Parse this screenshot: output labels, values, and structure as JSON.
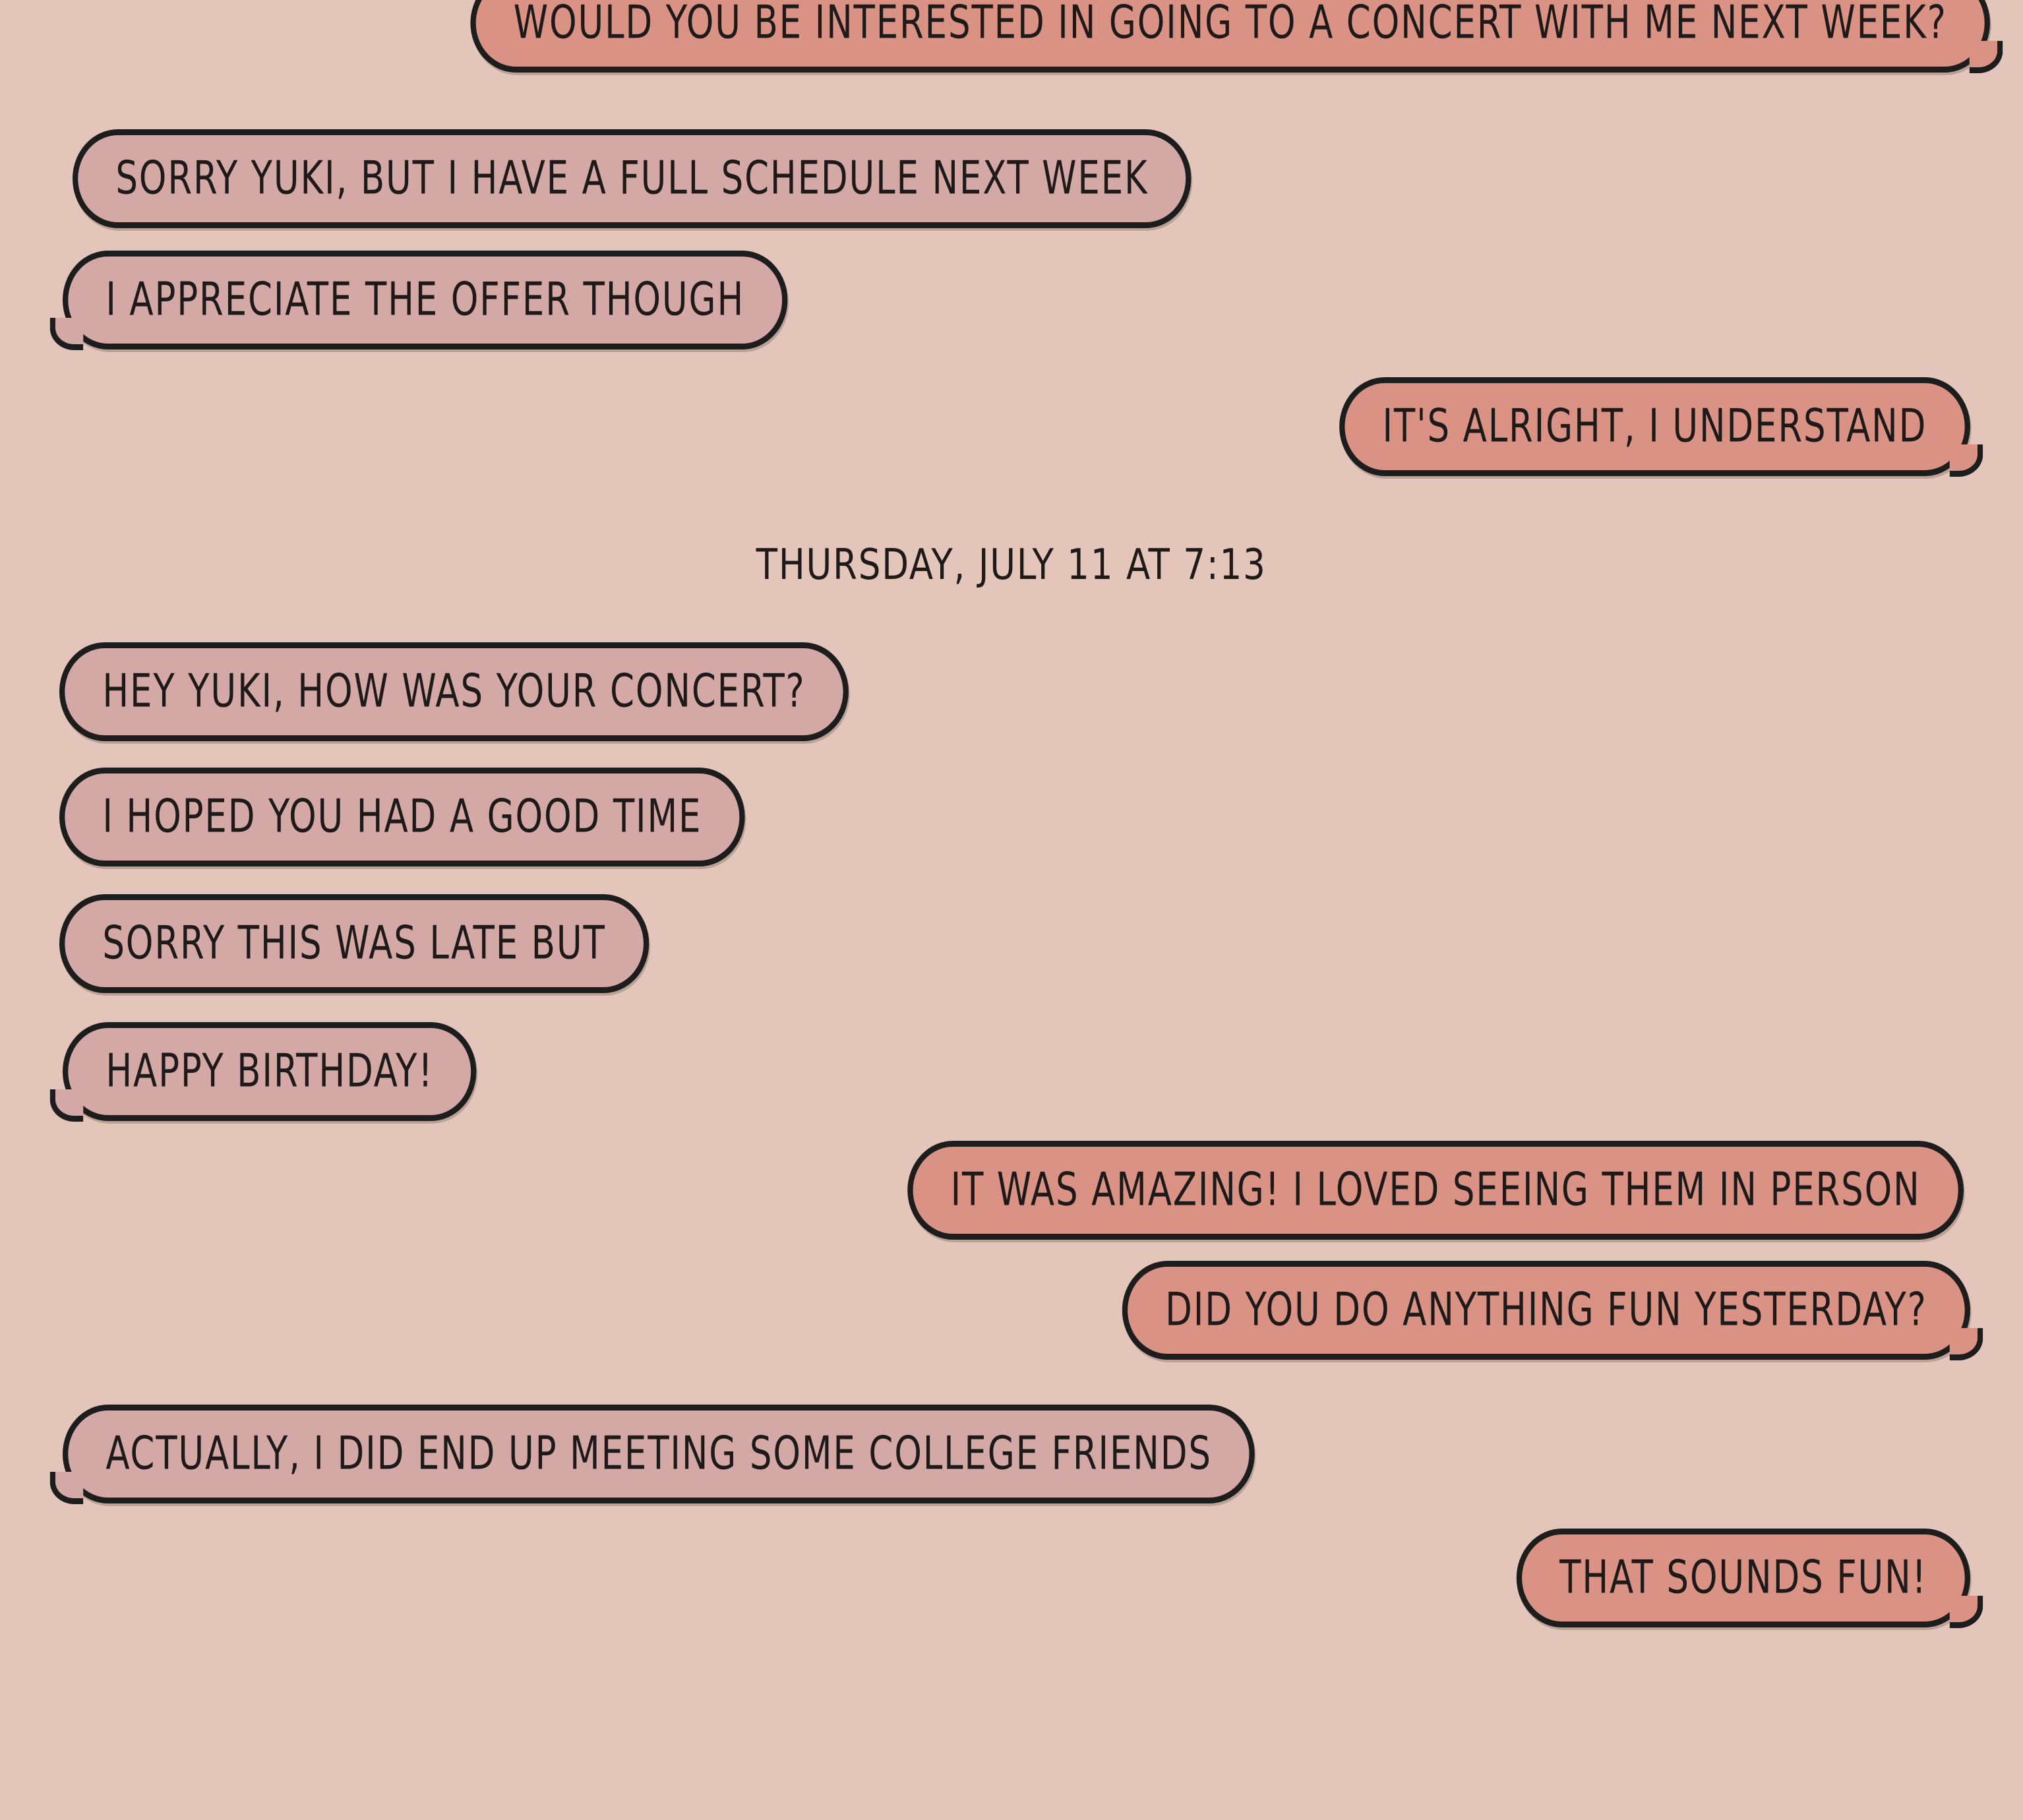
{
  "conversation": {
    "messages": [
      {
        "text": "WOULD YOU BE INTERESTED IN GOING TO A CONCERT WITH ME NEXT WEEK?",
        "sender": "self"
      },
      {
        "text": "SORRY YUKI, BUT I HAVE A FULL SCHEDULE NEXT WEEK",
        "sender": "other"
      },
      {
        "text": "I APPRECIATE THE OFFER THOUGH",
        "sender": "other"
      },
      {
        "text": "IT'S ALRIGHT, I UNDERSTAND",
        "sender": "self"
      },
      {
        "text": "HEY YUKI, HOW WAS YOUR CONCERT?",
        "sender": "other"
      },
      {
        "text": "I HOPED YOU HAD A GOOD TIME",
        "sender": "other"
      },
      {
        "text": "SORRY THIS WAS LATE BUT",
        "sender": "other"
      },
      {
        "text": "HAPPY BIRTHDAY!",
        "sender": "other"
      },
      {
        "text": "IT WAS AMAZING! I LOVED SEEING THEM IN PERSON",
        "sender": "self"
      },
      {
        "text": "DID YOU DO ANYTHING FUN YESTERDAY?",
        "sender": "self"
      },
      {
        "text": "ACTUALLY, I DID END UP MEETING SOME COLLEGE FRIENDS",
        "sender": "other"
      },
      {
        "text": "THAT SOUNDS FUN!",
        "sender": "self"
      }
    ],
    "timestamp": "THURSDAY, JULY 11 AT 7:13"
  },
  "colors": {
    "background": "#e3c6b9",
    "received_bubble": "#d4a8a5",
    "sent_bubble": "#d99283",
    "outline": "#1d1d1d"
  }
}
